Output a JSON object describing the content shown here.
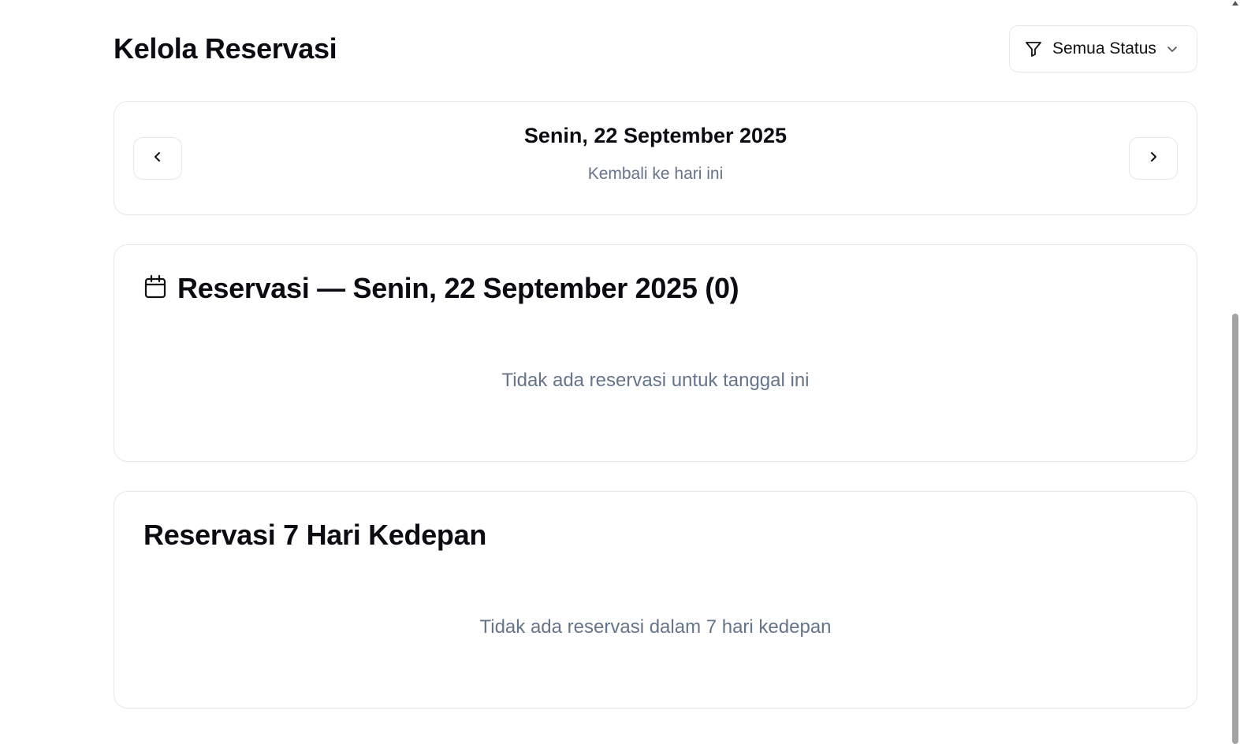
{
  "header": {
    "title": "Kelola Reservasi",
    "filter_label": "Semua Status"
  },
  "date_nav": {
    "current_date": "Senin, 22 September 2025",
    "back_today": "Kembali ke hari ini"
  },
  "today_section": {
    "title": "Reservasi — Senin, 22 September 2025 (0)",
    "empty_text": "Tidak ada reservasi untuk tanggal ini"
  },
  "week_section": {
    "title": "Reservasi 7 Hari Kedepan",
    "empty_text": "Tidak ada reservasi dalam 7 hari kedepan"
  },
  "icons": {
    "filter": "filter-icon",
    "chevron_down": "chevron-down-icon",
    "prev": "chevron-left-icon",
    "next": "chevron-right-icon",
    "calendar": "calendar-icon"
  },
  "colors": {
    "muted_text": "#64748b",
    "border": "#e5e7eb",
    "text": "#0b0b14"
  }
}
